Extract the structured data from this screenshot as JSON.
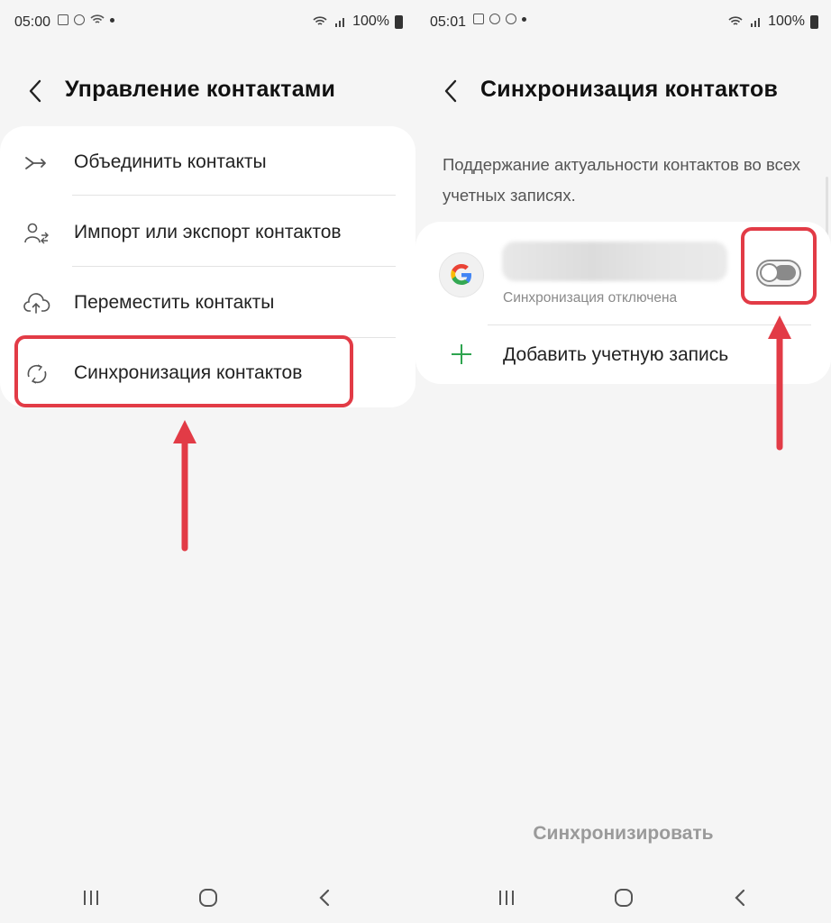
{
  "left": {
    "status": {
      "time": "05:00",
      "battery": "100%"
    },
    "header": {
      "title": "Управление контактами"
    },
    "menu": [
      {
        "label": "Объединить контакты",
        "icon": "merge-icon"
      },
      {
        "label": "Импорт или экспорт контактов",
        "icon": "import-export-icon"
      },
      {
        "label": "Переместить контакты",
        "icon": "cloud-upload-icon"
      },
      {
        "label": "Синхронизация контактов",
        "icon": "sync-icon"
      }
    ]
  },
  "right": {
    "status": {
      "time": "05:01",
      "battery": "100%"
    },
    "header": {
      "title": "Синхронизация контактов"
    },
    "description": "Поддержание актуальности контактов во всех учетных записях.",
    "account": {
      "status": "Синхронизация отключена",
      "sync_enabled": false
    },
    "add_account_label": "Добавить учетную запись",
    "sync_button_label": "Синхронизировать"
  },
  "colors": {
    "highlight": "#e23b46",
    "add_icon": "#2ea44f"
  }
}
